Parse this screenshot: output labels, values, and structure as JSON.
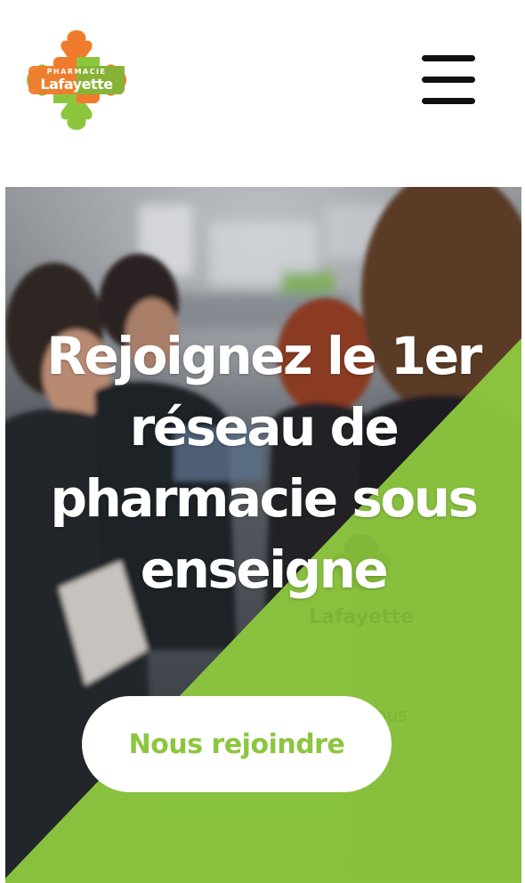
{
  "header": {
    "logo": {
      "line1": "PHARMACIE",
      "line2": "Lafayette",
      "colors": {
        "orange": "#f07b2c",
        "green": "#8cc63f"
      }
    },
    "menu_icon": "hamburger-menu-icon"
  },
  "hero": {
    "title": "Rejoignez le 1er réseau de pharmacie sous enseigne",
    "cta_label": "Nous rejoindre",
    "accent_color": "#8cc63f",
    "shirt_text": "Lafayette",
    "shirt_text_2": "tous"
  }
}
